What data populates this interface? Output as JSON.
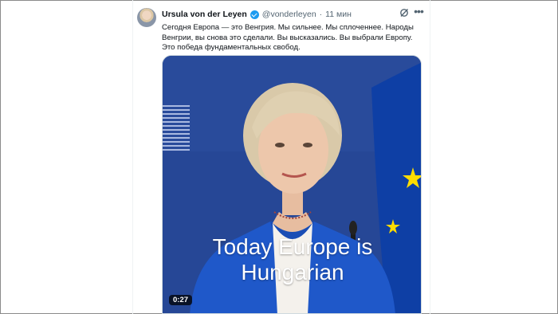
{
  "author": {
    "display_name": "Ursula von der Leyen",
    "handle": "@vonderleyen",
    "separator": "·",
    "timestamp": "11 мин"
  },
  "tweet": {
    "text": "Сегодня Европа — это Венгрия. Мы сильнее. Мы сплоченнее. Народы Венгрии, вы снова это сделали. Вы высказались. Вы выбрали Европу. Это победа фундаментальных свобод."
  },
  "video": {
    "caption_line1": "Today Europe is",
    "caption_line2": "Hungarian",
    "duration": "0:27"
  },
  "icons": [
    "verified-badge-icon",
    "grok-icon",
    "more-options-icon"
  ],
  "colors": {
    "verified": "#1d9bf0",
    "secondary_text": "#536471",
    "eu_flag_blue": "#0e3fa5",
    "eu_star_yellow": "#ffdd00",
    "jacket_blue": "#1f58c9"
  }
}
